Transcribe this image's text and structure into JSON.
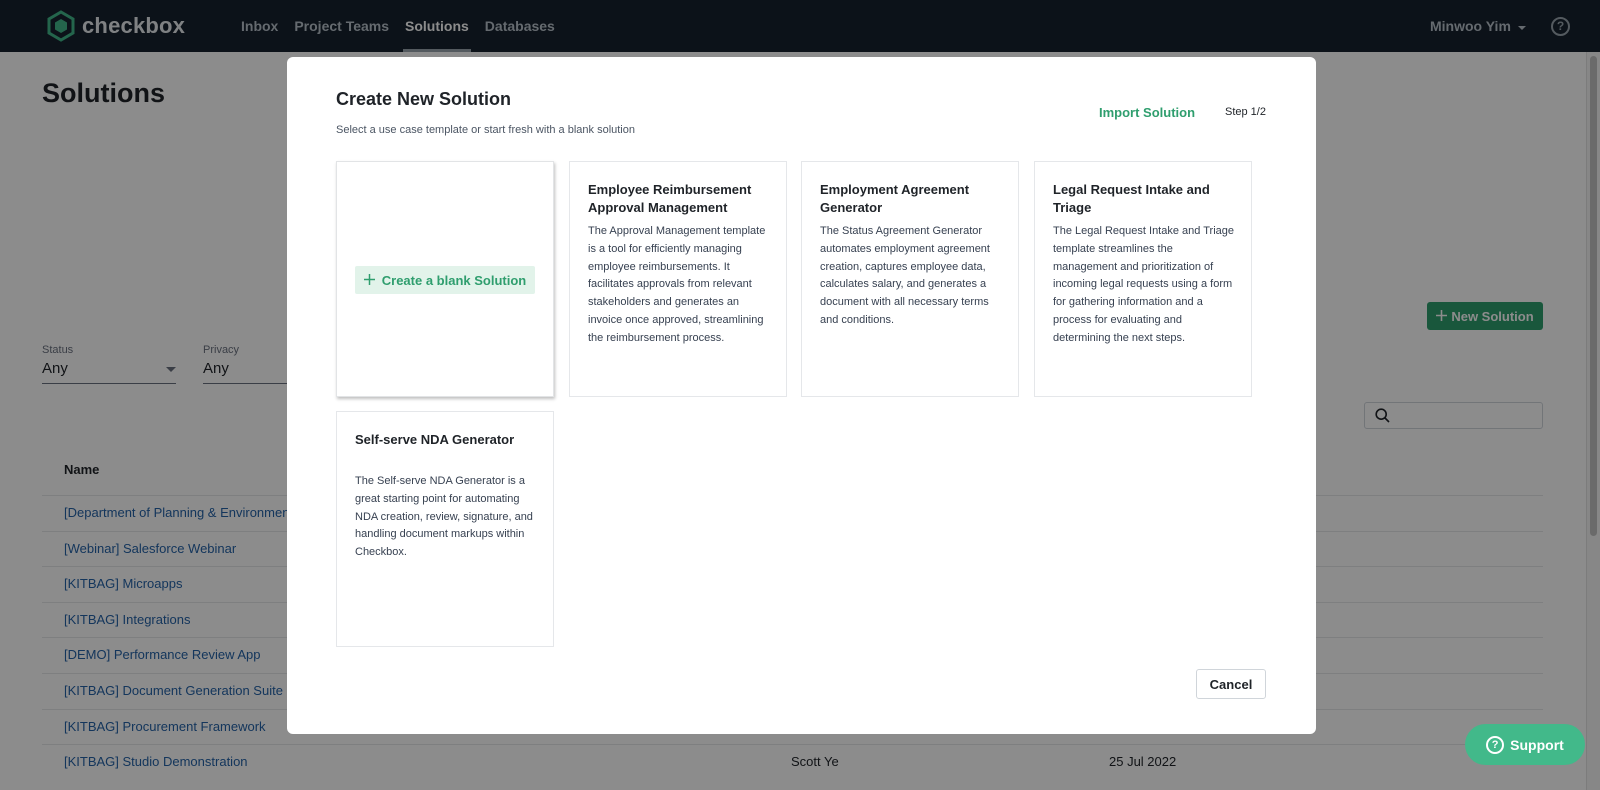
{
  "app": {
    "logo_text": "checkbox",
    "nav": [
      "Inbox",
      "Project Teams",
      "Solutions",
      "Databases"
    ],
    "active_nav": "Solutions",
    "user_name": "Minwoo Yim",
    "help_glyph": "?"
  },
  "page": {
    "title": "Solutions",
    "new_solution_label": "New Solution",
    "filters": {
      "status_label": "Status",
      "status_value": "Any",
      "privacy_label": "Privacy",
      "privacy_value": "Any"
    },
    "table": {
      "name_header": "Name",
      "rows": [
        {
          "name": "[Department of Planning & Environment]",
          "owner": "",
          "date": ""
        },
        {
          "name": "[Webinar] Salesforce Webinar",
          "owner": "",
          "date": ""
        },
        {
          "name": "[KITBAG] Microapps",
          "owner": "",
          "date": ""
        },
        {
          "name": "[KITBAG] Integrations",
          "owner": "",
          "date": ""
        },
        {
          "name": "[DEMO] Performance Review App",
          "owner": "",
          "date": ""
        },
        {
          "name": "[KITBAG] Document Generation Suite",
          "owner": "",
          "date": ""
        },
        {
          "name": "[KITBAG] Procurement Framework",
          "owner": "",
          "date": ""
        },
        {
          "name": "[KITBAG] Studio Demonstration",
          "owner": "Scott Ye",
          "date": "25 Jul 2022"
        }
      ]
    }
  },
  "modal": {
    "title": "Create New Solution",
    "subtitle": "Select a use case template or start fresh with a blank solution",
    "import_label": "Import Solution",
    "step_label": "Step 1/2",
    "blank_label": "Create a blank Solution",
    "templates": [
      {
        "title": "Employee Reimbursement Approval Management",
        "description": "The Approval Management template is a tool for efficiently managing employee reimbursements. It facilitates approvals from relevant stakeholders and generates an invoice once approved, streamlining the reimbursement process."
      },
      {
        "title": "Employment Agreement Generator",
        "description": "The Status Agreement Generator automates employment agreement creation, captures employee data, calculates salary, and generates a document with all necessary terms and conditions."
      },
      {
        "title": "Legal Request Intake and Triage",
        "description": "The Legal Request Intake and Triage template streamlines the management and prioritization of incoming legal requests using a form for gathering information and a process for evaluating and determining the next steps."
      },
      {
        "title": "Self-serve NDA Generator",
        "description": "The Self-serve NDA Generator is a great starting point for automating NDA creation, review, signature, and handling document markups within Checkbox."
      }
    ],
    "cancel_label": "Cancel"
  },
  "support": {
    "label": "Support",
    "glyph": "?"
  },
  "colors": {
    "nav_bg": "#16222e",
    "brand_green": "#2f9e6e",
    "support_green": "#42b98a",
    "link_blue": "#2563a8"
  },
  "icons": [
    "checkbox-logo-icon",
    "chevron-down-icon",
    "help-icon",
    "plus-icon",
    "search-icon",
    "support-icon"
  ]
}
